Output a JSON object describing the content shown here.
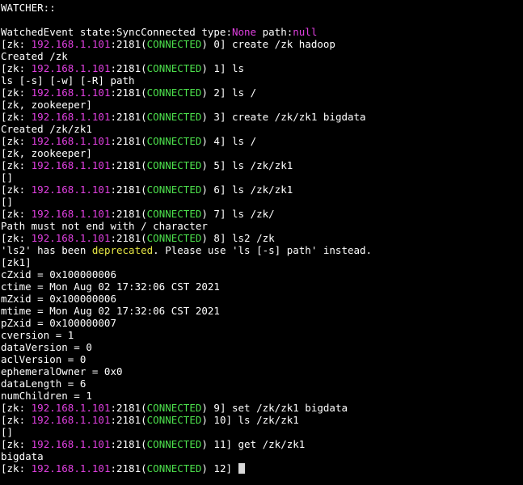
{
  "colors": {
    "background": "#000000",
    "default_text": "#ffffff",
    "magenta": "#e040e0",
    "green": "#4ce04c",
    "yellow": "#e6e645"
  },
  "lines": [
    {
      "kind": "output",
      "segments": [
        {
          "text": "WATCHER::",
          "color": "w"
        }
      ]
    },
    {
      "kind": "output",
      "segments": []
    },
    {
      "kind": "output",
      "segments": [
        {
          "text": "WatchedEvent state:SyncConnected type:",
          "color": "w"
        },
        {
          "text": "None",
          "color": "m"
        },
        {
          "text": " path:",
          "color": "w"
        },
        {
          "text": "null",
          "color": "m"
        }
      ]
    },
    {
      "kind": "prompt",
      "segments": [
        {
          "text": "[zk: ",
          "color": "w"
        },
        {
          "text": "192.168.1.101",
          "color": "m"
        },
        {
          "text": ":2181(",
          "color": "w"
        },
        {
          "text": "CONNECTED",
          "color": "g"
        },
        {
          "text": ") 0] create /zk hadoop",
          "color": "w"
        }
      ]
    },
    {
      "kind": "output",
      "segments": [
        {
          "text": "Created /zk",
          "color": "w"
        }
      ]
    },
    {
      "kind": "prompt",
      "segments": [
        {
          "text": "[zk: ",
          "color": "w"
        },
        {
          "text": "192.168.1.101",
          "color": "m"
        },
        {
          "text": ":2181(",
          "color": "w"
        },
        {
          "text": "CONNECTED",
          "color": "g"
        },
        {
          "text": ") 1] ls",
          "color": "w"
        }
      ]
    },
    {
      "kind": "output",
      "segments": [
        {
          "text": "ls [-s] [-w] [-R] path",
          "color": "w"
        }
      ]
    },
    {
      "kind": "prompt",
      "segments": [
        {
          "text": "[zk: ",
          "color": "w"
        },
        {
          "text": "192.168.1.101",
          "color": "m"
        },
        {
          "text": ":2181(",
          "color": "w"
        },
        {
          "text": "CONNECTED",
          "color": "g"
        },
        {
          "text": ") 2] ls /",
          "color": "w"
        }
      ]
    },
    {
      "kind": "output",
      "segments": [
        {
          "text": "[zk, zookeeper]",
          "color": "w"
        }
      ]
    },
    {
      "kind": "prompt",
      "segments": [
        {
          "text": "[zk: ",
          "color": "w"
        },
        {
          "text": "192.168.1.101",
          "color": "m"
        },
        {
          "text": ":2181(",
          "color": "w"
        },
        {
          "text": "CONNECTED",
          "color": "g"
        },
        {
          "text": ") 3] create /zk/zk1 bigdata",
          "color": "w"
        }
      ]
    },
    {
      "kind": "output",
      "segments": [
        {
          "text": "Created /zk/zk1",
          "color": "w"
        }
      ]
    },
    {
      "kind": "prompt",
      "segments": [
        {
          "text": "[zk: ",
          "color": "w"
        },
        {
          "text": "192.168.1.101",
          "color": "m"
        },
        {
          "text": ":2181(",
          "color": "w"
        },
        {
          "text": "CONNECTED",
          "color": "g"
        },
        {
          "text": ") 4] ls /",
          "color": "w"
        }
      ]
    },
    {
      "kind": "output",
      "segments": [
        {
          "text": "[zk, zookeeper]",
          "color": "w"
        }
      ]
    },
    {
      "kind": "prompt",
      "segments": [
        {
          "text": "[zk: ",
          "color": "w"
        },
        {
          "text": "192.168.1.101",
          "color": "m"
        },
        {
          "text": ":2181(",
          "color": "w"
        },
        {
          "text": "CONNECTED",
          "color": "g"
        },
        {
          "text": ") 5] ls /zk/zk1",
          "color": "w"
        }
      ]
    },
    {
      "kind": "output",
      "segments": [
        {
          "text": "[]",
          "color": "w"
        }
      ]
    },
    {
      "kind": "prompt",
      "segments": [
        {
          "text": "[zk: ",
          "color": "w"
        },
        {
          "text": "192.168.1.101",
          "color": "m"
        },
        {
          "text": ":2181(",
          "color": "w"
        },
        {
          "text": "CONNECTED",
          "color": "g"
        },
        {
          "text": ") 6] ls /zk/zk1",
          "color": "w"
        }
      ]
    },
    {
      "kind": "output",
      "segments": [
        {
          "text": "[]",
          "color": "w"
        }
      ]
    },
    {
      "kind": "prompt",
      "segments": [
        {
          "text": "[zk: ",
          "color": "w"
        },
        {
          "text": "192.168.1.101",
          "color": "m"
        },
        {
          "text": ":2181(",
          "color": "w"
        },
        {
          "text": "CONNECTED",
          "color": "g"
        },
        {
          "text": ") 7] ls /zk/",
          "color": "w"
        }
      ]
    },
    {
      "kind": "output",
      "segments": [
        {
          "text": "Path must not end with / character",
          "color": "w"
        }
      ]
    },
    {
      "kind": "prompt",
      "segments": [
        {
          "text": "[zk: ",
          "color": "w"
        },
        {
          "text": "192.168.1.101",
          "color": "m"
        },
        {
          "text": ":2181(",
          "color": "w"
        },
        {
          "text": "CONNECTED",
          "color": "g"
        },
        {
          "text": ") 8] ls2 /zk",
          "color": "w"
        }
      ]
    },
    {
      "kind": "output",
      "segments": [
        {
          "text": "'ls2' has been ",
          "color": "w"
        },
        {
          "text": "deprecated",
          "color": "y"
        },
        {
          "text": ". Please use 'ls [-s] path' instead.",
          "color": "w"
        }
      ]
    },
    {
      "kind": "output",
      "segments": [
        {
          "text": "[zk1]",
          "color": "w"
        }
      ]
    },
    {
      "kind": "output",
      "segments": [
        {
          "text": "cZxid = 0x100000006",
          "color": "w"
        }
      ]
    },
    {
      "kind": "output",
      "segments": [
        {
          "text": "ctime = Mon Aug 02 17:32:06 CST 2021",
          "color": "w"
        }
      ]
    },
    {
      "kind": "output",
      "segments": [
        {
          "text": "mZxid = 0x100000006",
          "color": "w"
        }
      ]
    },
    {
      "kind": "output",
      "segments": [
        {
          "text": "mtime = Mon Aug 02 17:32:06 CST 2021",
          "color": "w"
        }
      ]
    },
    {
      "kind": "output",
      "segments": [
        {
          "text": "pZxid = 0x100000007",
          "color": "w"
        }
      ]
    },
    {
      "kind": "output",
      "segments": [
        {
          "text": "cversion = 1",
          "color": "w"
        }
      ]
    },
    {
      "kind": "output",
      "segments": [
        {
          "text": "dataVersion = 0",
          "color": "w"
        }
      ]
    },
    {
      "kind": "output",
      "segments": [
        {
          "text": "aclVersion = 0",
          "color": "w"
        }
      ]
    },
    {
      "kind": "output",
      "segments": [
        {
          "text": "ephemeralOwner = 0x0",
          "color": "w"
        }
      ]
    },
    {
      "kind": "output",
      "segments": [
        {
          "text": "dataLength = 6",
          "color": "w"
        }
      ]
    },
    {
      "kind": "output",
      "segments": [
        {
          "text": "numChildren = 1",
          "color": "w"
        }
      ]
    },
    {
      "kind": "prompt",
      "segments": [
        {
          "text": "[zk: ",
          "color": "w"
        },
        {
          "text": "192.168.1.101",
          "color": "m"
        },
        {
          "text": ":2181(",
          "color": "w"
        },
        {
          "text": "CONNECTED",
          "color": "g"
        },
        {
          "text": ") 9] set /zk/zk1 bigdata",
          "color": "w"
        }
      ]
    },
    {
      "kind": "prompt",
      "segments": [
        {
          "text": "[zk: ",
          "color": "w"
        },
        {
          "text": "192.168.1.101",
          "color": "m"
        },
        {
          "text": ":2181(",
          "color": "w"
        },
        {
          "text": "CONNECTED",
          "color": "g"
        },
        {
          "text": ") 10] ls /zk/zk1",
          "color": "w"
        }
      ]
    },
    {
      "kind": "output",
      "segments": [
        {
          "text": "[]",
          "color": "w"
        }
      ]
    },
    {
      "kind": "prompt",
      "segments": [
        {
          "text": "[zk: ",
          "color": "w"
        },
        {
          "text": "192.168.1.101",
          "color": "m"
        },
        {
          "text": ":2181(",
          "color": "w"
        },
        {
          "text": "CONNECTED",
          "color": "g"
        },
        {
          "text": ") 11] get /zk/zk1",
          "color": "w"
        }
      ]
    },
    {
      "kind": "output",
      "segments": [
        {
          "text": "bigdata",
          "color": "w"
        }
      ]
    },
    {
      "kind": "prompt",
      "segments": [
        {
          "text": "[zk: ",
          "color": "w"
        },
        {
          "text": "192.168.1.101",
          "color": "m"
        },
        {
          "text": ":2181(",
          "color": "w"
        },
        {
          "text": "CONNECTED",
          "color": "g"
        },
        {
          "text": ") 12] ",
          "color": "w"
        }
      ]
    }
  ],
  "cursor": {
    "visible": true
  }
}
